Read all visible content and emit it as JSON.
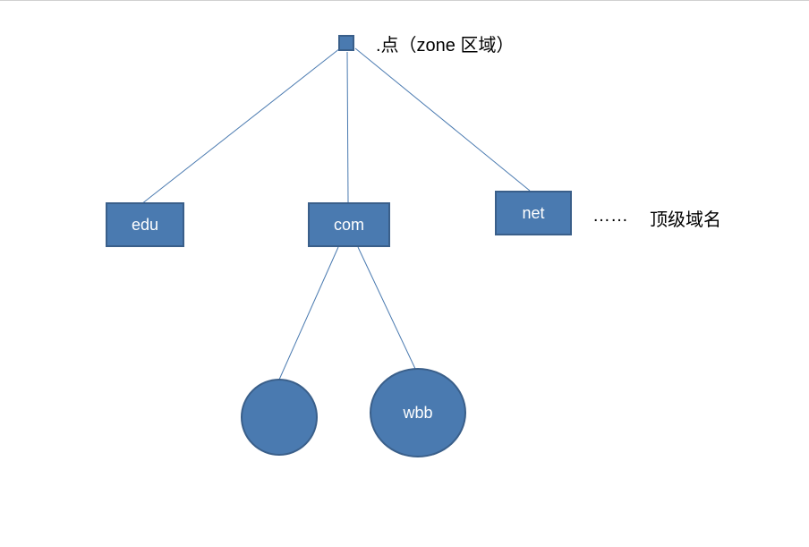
{
  "diagram": {
    "root": {
      "label_text": ".点（zone 区域）"
    },
    "tld_nodes": {
      "edu": "edu",
      "com": "com",
      "net": "net",
      "ellipsis": "……",
      "level_label": "顶级域名"
    },
    "sub_nodes": {
      "circle1": "",
      "circle2": "wbb"
    },
    "colors": {
      "node_fill": "#4a7ab0",
      "node_border": "#3a5f8a",
      "line": "#4a7ab0",
      "text_black": "#000000",
      "text_white": "#ffffff"
    }
  }
}
